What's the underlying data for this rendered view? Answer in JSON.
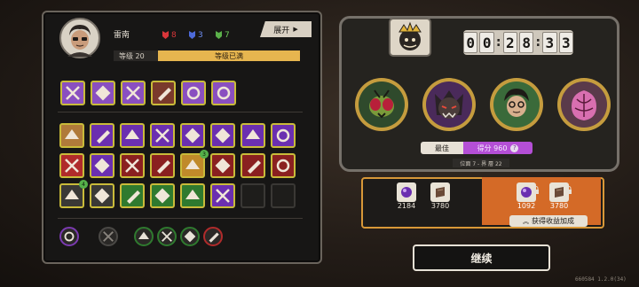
{
  "character": {
    "name": "雷南",
    "level_label": "等级 20",
    "level_status": "等级已满",
    "expand_label": "展开",
    "gems": [
      {
        "icon": "red-mask-icon",
        "count": "8",
        "color": "#d9363a"
      },
      {
        "icon": "blue-mask-icon",
        "count": "3",
        "color": "#4d6ad9"
      },
      {
        "icon": "green-mask-icon",
        "count": "7",
        "color": "#5bb04a"
      }
    ]
  },
  "equipment_row": [
    {
      "icon": "gauntlet-icon",
      "bg": "#8a4fc0"
    },
    {
      "icon": "blade-icon",
      "bg": "#8a4fc0"
    },
    {
      "icon": "belt-icon",
      "bg": "#8a4fc0"
    },
    {
      "icon": "chest-icon",
      "bg": "#7a3a2c"
    },
    {
      "icon": "boots-icon",
      "bg": "#8a4fc0"
    },
    {
      "icon": "backpack-icon",
      "bg": "#8a4fc0"
    }
  ],
  "skills_rows": [
    [
      {
        "icon": "swift-icon",
        "bg": "#b07a3a"
      },
      {
        "icon": "whirl-icon",
        "bg": "#6b2fb0"
      },
      {
        "icon": "wing-icon",
        "bg": "#6b2fb0"
      },
      {
        "icon": "axe-icon",
        "bg": "#6b2fb0"
      },
      {
        "icon": "slash-icon",
        "bg": "#6b2fb0"
      },
      {
        "icon": "crossed-blades-icon",
        "bg": "#6b2fb0"
      },
      {
        "icon": "beast-icon",
        "bg": "#6b2fb0"
      },
      {
        "icon": "triangle-rune-icon",
        "bg": "#6b2fb0"
      }
    ],
    [
      {
        "icon": "fire-swirl-icon",
        "bg": "#b02b2b"
      },
      {
        "icon": "demon-mask-icon",
        "bg": "#6b2fb0"
      },
      {
        "icon": "claw-icon",
        "bg": "#8a2020"
      },
      {
        "icon": "feather-icon",
        "bg": "#8a2020"
      },
      {
        "icon": "sunrise-icon",
        "bg": "#c08a2a",
        "badge": "3"
      },
      {
        "icon": "spear-icon",
        "bg": "#8a2020"
      },
      {
        "icon": "flame-claw-icon",
        "bg": "#8a2020"
      },
      {
        "icon": "brute-icon",
        "bg": "#8a2020"
      }
    ],
    [
      {
        "icon": "heart-armor-icon",
        "bg": "#3a3936",
        "badge": "4"
      },
      {
        "icon": "ghost-icon",
        "bg": "#3a3936"
      },
      {
        "icon": "dual-claw-icon",
        "bg": "#2f7a2f"
      },
      {
        "icon": "boomerang-icon",
        "bg": "#2f7a2f"
      },
      {
        "icon": "leaf-blade-icon",
        "bg": "#2f7a2f"
      },
      {
        "icon": "shuriken-icon",
        "bg": "#6b2fb0"
      },
      {
        "icon": "empty-slot",
        "bg": ""
      },
      {
        "icon": "empty-slot",
        "bg": ""
      }
    ]
  ],
  "bottom_buttons": [
    {
      "icon": "purple-rune-icon"
    },
    {
      "icon": "locked-rune-icon"
    },
    {
      "icon": "green-claw-icon"
    },
    {
      "icon": "green-slash-icon"
    },
    {
      "icon": "green-potion-icon"
    },
    {
      "icon": "red-arrow-icon"
    }
  ],
  "timer": {
    "digits": [
      "0",
      "0",
      "2",
      "8",
      "3",
      "3"
    ]
  },
  "score": {
    "best_label": "最佳",
    "score_label": "得分 960",
    "position_label": "位面 7 - 界 層 22"
  },
  "portraits": [
    {
      "name": "fly-boss-portrait"
    },
    {
      "name": "dark-beast-portrait"
    },
    {
      "name": "hero-portrait"
    },
    {
      "name": "pink-ghost-portrait"
    }
  ],
  "rewards": [
    {
      "icon": "purple-orb-icon",
      "value": "2184"
    },
    {
      "icon": "brown-token-icon",
      "value": "3780"
    },
    {
      "icon": "purple-orb-icon",
      "value": "1092"
    },
    {
      "icon": "brown-token-icon",
      "value": "3780"
    }
  ],
  "bonus_label": "获得收益加成",
  "continue_label": "继续",
  "version": "660584 1.2.0(34)"
}
